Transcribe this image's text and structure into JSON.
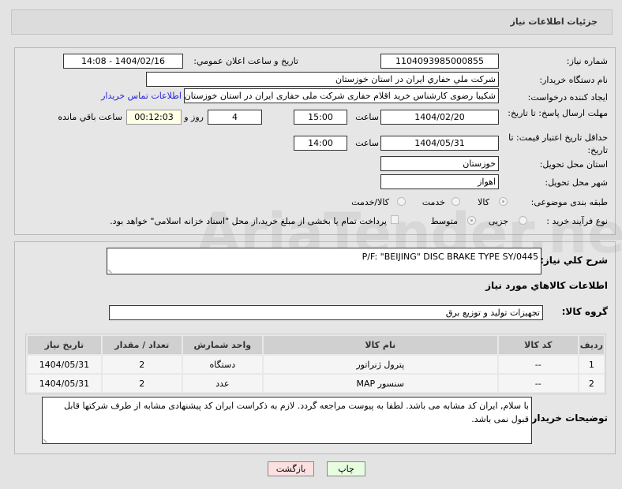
{
  "header": {
    "title": "جزئیات اطلاعات نیاز"
  },
  "form": {
    "need_number_label": "شماره نیاز:",
    "need_number": "1104093985000855",
    "announce_label": "تاریخ و ساعت اعلان عمومي:",
    "announce_value": "1404/02/16 - 14:08",
    "buyer_label": "نام دستگاه خریدار:",
    "buyer_value": "شرکت ملي حفاري ايران در استان خوزستان",
    "creator_label": "ایجاد کننده درخواست:",
    "creator_value": "شکیبا رضوی کارشناس خرید اقلام حفاری شرکت ملی حفاری ایران در استان خوزستان",
    "contact_link": "اطلاعات تماس خریدار",
    "deadline_label": "مهلت ارسال پاسخ: تا تاریخ:",
    "deadline_date": "1404/02/20",
    "hour_label": "ساعت",
    "deadline_time": "15:00",
    "days": "4",
    "days_label": "روز و",
    "remaining": "00:12:03",
    "remaining_label": "ساعت باقي مانده",
    "validity_label": "حداقل تاریخ اعتبار قیمت: تا تاریخ:",
    "validity_date": "1404/05/31",
    "validity_time": "14:00",
    "province_label": "استان محل تحویل:",
    "province": "خوزستان",
    "city_label": "شهر محل تحویل:",
    "city": "اهواز",
    "category_label": "طبقه بندی موضوعی:",
    "category_options": [
      "کالا",
      "خدمت",
      "کالا/خدمت"
    ],
    "category_selected": "کالا",
    "process_label": "نوع فرآیند خرید :",
    "process_options": [
      "جزیی",
      "متوسط"
    ],
    "process_selected": "متوسط",
    "payment_note": "پرداخت تمام یا بخشی از مبلغ خرید،از محل \"اسناد خزانه اسلامی\" خواهد بود."
  },
  "details": {
    "desc_label": "شرح کلي نیاز:",
    "desc_value": "P/F: \"BEIJING\" DISC BRAKE TYPE SY/0445",
    "goods_heading": "اطلاعات کالاهاي مورد نیاز",
    "group_label": "گروه کالا:",
    "group_value": "تجهیزات تولید و توزیع برق",
    "table": {
      "headers": [
        "ردیف",
        "کد کالا",
        "نام کالا",
        "واحد شمارش",
        "تعداد / مقدار",
        "تاریخ نیاز"
      ],
      "rows": [
        [
          "1",
          "--",
          "پترول ژنراتور",
          "دستگاه",
          "2",
          "1404/05/31"
        ],
        [
          "2",
          "--",
          "سنسور MAP",
          "عدد",
          "2",
          "1404/05/31"
        ]
      ]
    },
    "notes_label": "توضیحات خریدار:",
    "notes_value": "با سلام, ایران کد مشابه می باشد. لطفا به پیوست مراجعه گردد. لازم به ذکراست ایران کد پیشنهادی مشابه از طرف شرکتها قابل قبول نمی باشد."
  },
  "buttons": {
    "print": "چاپ",
    "back": "بازگشت"
  },
  "watermark": "AriaTender.net"
}
